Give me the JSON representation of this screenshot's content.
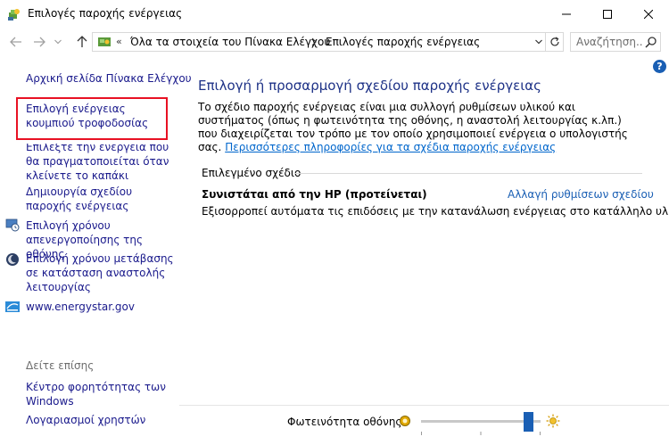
{
  "window": {
    "title": "Επιλογές παροχής ενέργειας"
  },
  "address": {
    "prefix": "«",
    "crumbs": [
      "Όλα τα στοιχεία του Πίνακα Ελέγχου",
      "Επιλογές παροχής ενέργειας"
    ]
  },
  "search": {
    "placeholder": "Αναζήτηση..."
  },
  "sidebar": {
    "home": "Αρχική σελίδα Πίνακα Ελέγχου",
    "items": [
      "Επιλογή ενέργειας κουμπιού τροφοδοσίας",
      "Επιλέξτε την ενέργεια που θα πραγματοποιείται όταν κλείνετε το καπάκι",
      "Δημιουργία σχεδίου παροχής ενέργειας",
      "Επιλογή χρόνου απενεργοποίησης της οθόνης",
      "Επιλογή χρόνου μετάβασης σε κατάσταση αναστολής λειτουργίας",
      "www.energystar.gov"
    ],
    "see_also_label": "Δείτε επίσης",
    "see_also": [
      "Κέντρο φορητότητας των Windows",
      "Λογαριασμοί χρηστών"
    ]
  },
  "main": {
    "title": "Επιλογή ή προσαρμογή σχεδίου παροχής ενέργειας",
    "description": "Το σχέδιο παροχής ενέργειας είναι μια συλλογή ρυθμίσεων υλικού και συστήματος (όπως η φωτεινότητα της οθόνης, η αναστολή λειτουργίας κ.λπ.) που διαχειρίζεται τον τρόπο με τον οποίο χρησιμοποιεί ενέργεια ο υπολογιστής σας.",
    "more_info_link": "Περισσότερες πληροφορίες για τα σχέδια παροχής ενέργειας",
    "group_label": "Επιλεγμένο σχέδιο",
    "plan_name": "Συνιστάται από την HP (προτείνεται)",
    "plan_change": "Αλλαγή ρυθμίσεων σχεδίου",
    "plan_description": "Εξισορροπεί αυτόματα τις επιδόσεις με την κατανάλωση ενέργειας στο κατάλληλο υλικό."
  },
  "footer": {
    "brightness_label": "Φωτεινότητα οθόνης:",
    "brightness_value": 0.9
  },
  "help": {
    "label": "?"
  },
  "colors": {
    "accent": "#1a5fb4",
    "title": "#1e3287",
    "link": "#1a1a8c",
    "highlight": "#e81123"
  }
}
